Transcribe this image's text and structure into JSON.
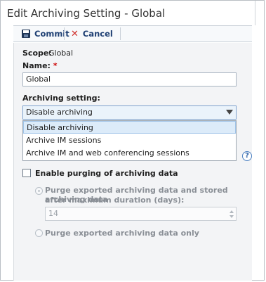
{
  "window": {
    "title": "Edit Archiving Setting - Global"
  },
  "toolbar": {
    "commit_label": "Commit",
    "cancel_label": "Cancel"
  },
  "form": {
    "scope_label": "Scope:",
    "scope_value": "Global",
    "name_label": "Name:",
    "name_required_mark": "*",
    "name_value": "Global",
    "archiving_label": "Archiving setting:",
    "archiving_selected": "Disable archiving",
    "archiving_options": [
      "Disable archiving",
      "Archive IM sessions",
      "Archive IM and web conferencing sessions"
    ],
    "help_icon_text": "?",
    "purge_checkbox_label": "Enable purging of archiving data",
    "purge_radio1_label_line1": "Purge exported archiving data and stored archiving data",
    "purge_radio1_label_line2": "after maximum duration (days):",
    "max_duration_value": "14",
    "purge_radio2_label": "Purge exported archiving data only"
  }
}
